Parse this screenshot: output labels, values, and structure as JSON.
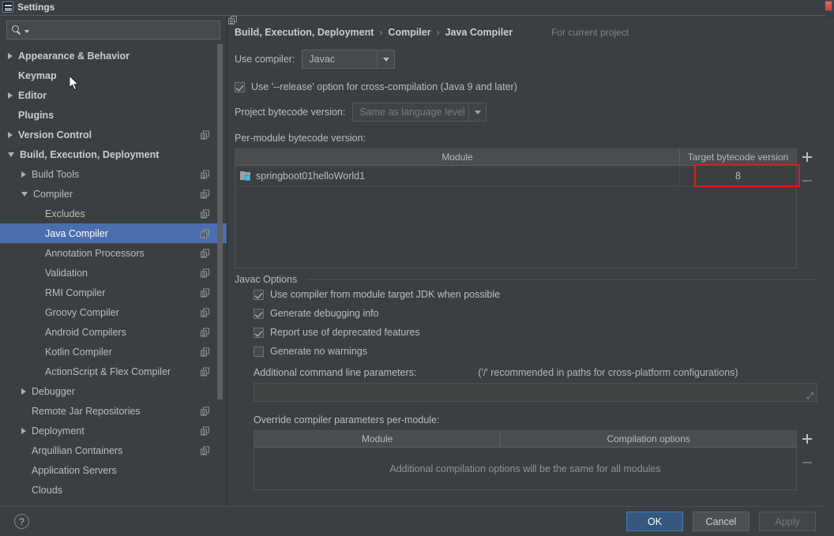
{
  "window": {
    "title": "Settings"
  },
  "sidebar": {
    "search": {
      "value": "",
      "placeholder": ""
    },
    "items": [
      {
        "label": "Appearance & Behavior",
        "arrow": "collapsed",
        "indent": 0,
        "bold": true,
        "scope": false,
        "selected": false
      },
      {
        "label": "Keymap",
        "arrow": "none",
        "indent": 0,
        "bold": true,
        "scope": false,
        "selected": false
      },
      {
        "label": "Editor",
        "arrow": "collapsed",
        "indent": 0,
        "bold": true,
        "scope": false,
        "selected": false
      },
      {
        "label": "Plugins",
        "arrow": "none",
        "indent": 0,
        "bold": true,
        "scope": false,
        "selected": false
      },
      {
        "label": "Version Control",
        "arrow": "collapsed",
        "indent": 0,
        "bold": true,
        "scope": true,
        "selected": false
      },
      {
        "label": "Build, Execution, Deployment",
        "arrow": "expanded",
        "indent": 0,
        "bold": true,
        "scope": false,
        "selected": false
      },
      {
        "label": "Build Tools",
        "arrow": "collapsed",
        "indent": 1,
        "bold": false,
        "scope": true,
        "selected": false
      },
      {
        "label": "Compiler",
        "arrow": "expanded",
        "indent": 1,
        "bold": false,
        "scope": true,
        "selected": false
      },
      {
        "label": "Excludes",
        "arrow": "none",
        "indent": 2,
        "bold": false,
        "scope": true,
        "selected": false
      },
      {
        "label": "Java Compiler",
        "arrow": "none",
        "indent": 2,
        "bold": false,
        "scope": true,
        "selected": true
      },
      {
        "label": "Annotation Processors",
        "arrow": "none",
        "indent": 2,
        "bold": false,
        "scope": true,
        "selected": false
      },
      {
        "label": "Validation",
        "arrow": "none",
        "indent": 2,
        "bold": false,
        "scope": true,
        "selected": false
      },
      {
        "label": "RMI Compiler",
        "arrow": "none",
        "indent": 2,
        "bold": false,
        "scope": true,
        "selected": false
      },
      {
        "label": "Groovy Compiler",
        "arrow": "none",
        "indent": 2,
        "bold": false,
        "scope": true,
        "selected": false
      },
      {
        "label": "Android Compilers",
        "arrow": "none",
        "indent": 2,
        "bold": false,
        "scope": true,
        "selected": false
      },
      {
        "label": "Kotlin Compiler",
        "arrow": "none",
        "indent": 2,
        "bold": false,
        "scope": true,
        "selected": false
      },
      {
        "label": "ActionScript & Flex Compiler",
        "arrow": "none",
        "indent": 2,
        "bold": false,
        "scope": true,
        "selected": false
      },
      {
        "label": "Debugger",
        "arrow": "collapsed",
        "indent": 1,
        "bold": false,
        "scope": false,
        "selected": false
      },
      {
        "label": "Remote Jar Repositories",
        "arrow": "none",
        "indent": 1,
        "bold": false,
        "scope": true,
        "selected": false
      },
      {
        "label": "Deployment",
        "arrow": "collapsed",
        "indent": 1,
        "bold": false,
        "scope": true,
        "selected": false
      },
      {
        "label": "Arquillian Containers",
        "arrow": "none",
        "indent": 1,
        "bold": false,
        "scope": true,
        "selected": false
      },
      {
        "label": "Application Servers",
        "arrow": "none",
        "indent": 1,
        "bold": false,
        "scope": false,
        "selected": false
      },
      {
        "label": "Clouds",
        "arrow": "none",
        "indent": 1,
        "bold": false,
        "scope": false,
        "selected": false
      }
    ]
  },
  "main": {
    "breadcrumb": [
      "Build, Execution, Deployment",
      "Compiler",
      "Java Compiler"
    ],
    "breadcrumb_separator": "›",
    "scope_note": "For current project",
    "use_compiler": {
      "label": "Use compiler:",
      "value": "Javac"
    },
    "release_option": {
      "label": "Use '--release' option for cross-compilation (Java 9 and later)",
      "checked": true
    },
    "project_bytecode": {
      "label": "Project bytecode version:",
      "value": "Same as language level",
      "disabled": true
    },
    "per_module_label": "Per-module bytecode version:",
    "module_table": {
      "headers": [
        "Module",
        "Target bytecode version"
      ],
      "rows": [
        {
          "module": "springboot01helloWorld1",
          "target": "8",
          "highlighted": true
        }
      ],
      "add_label": "+",
      "remove_label": "−"
    },
    "javac_options": {
      "legend": "Javac Options",
      "checkboxes": [
        {
          "label": "Use compiler from module target JDK when possible",
          "checked": true
        },
        {
          "label": "Generate debugging info",
          "checked": true
        },
        {
          "label": "Report use of deprecated features",
          "checked": true
        },
        {
          "label": "Generate no warnings",
          "checked": false
        }
      ],
      "params_label": "Additional command line parameters:",
      "params_hint": "('/' recommended in paths for cross-platform configurations)",
      "params_value": "",
      "override_label": "Override compiler parameters per-module:",
      "override_table": {
        "headers": [
          "Module",
          "Compilation options"
        ],
        "empty_message": "Additional compilation options will be the same for all modules",
        "add_label": "+",
        "remove_label": "−"
      }
    }
  },
  "footer": {
    "help_label": "?",
    "ok_label": "OK",
    "cancel_label": "Cancel",
    "apply_label": "Apply",
    "apply_disabled": true
  },
  "colors": {
    "background": "#3c3f41",
    "selection": "#4b6eaf",
    "primary_button": "#365880",
    "annotation": "#e01b1b",
    "module_chip": "#44c0e8"
  }
}
